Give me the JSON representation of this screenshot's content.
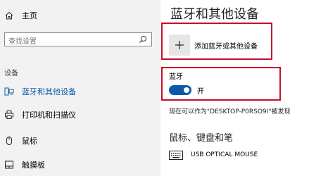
{
  "sidebar": {
    "home": {
      "label": "主页",
      "icon": "home-icon"
    },
    "search": {
      "placeholder": "查找设置",
      "icon": "search-icon"
    },
    "section_label": "设备",
    "items": [
      {
        "label": "蓝牙和其他设备",
        "icon": "bluetooth-devices-icon",
        "active": true
      },
      {
        "label": "打印机和扫描仪",
        "icon": "printer-icon",
        "active": false
      },
      {
        "label": "鼠标",
        "icon": "mouse-icon",
        "active": false
      },
      {
        "label": "触摸板",
        "icon": "touchpad-icon",
        "active": false
      }
    ]
  },
  "main": {
    "title": "蓝牙和其他设备",
    "add_device": {
      "label": "添加蓝牙或其他设备",
      "icon": "plus-icon"
    },
    "bluetooth": {
      "label": "蓝牙",
      "toggle_on": true,
      "state_label": "开"
    },
    "discoverable_text": "现在可以作为\"DESKTOP-P0RSO9I\"被发现",
    "subheading": "鼠标、键盘和笔",
    "devices": [
      {
        "name": "USB OPTICAL MOUSE",
        "icon": "keyboard-icon"
      }
    ]
  },
  "colors": {
    "accent": "#0a5aa8",
    "highlight_box": "#c5102a",
    "sidebar_bg": "#f2f2f2"
  }
}
